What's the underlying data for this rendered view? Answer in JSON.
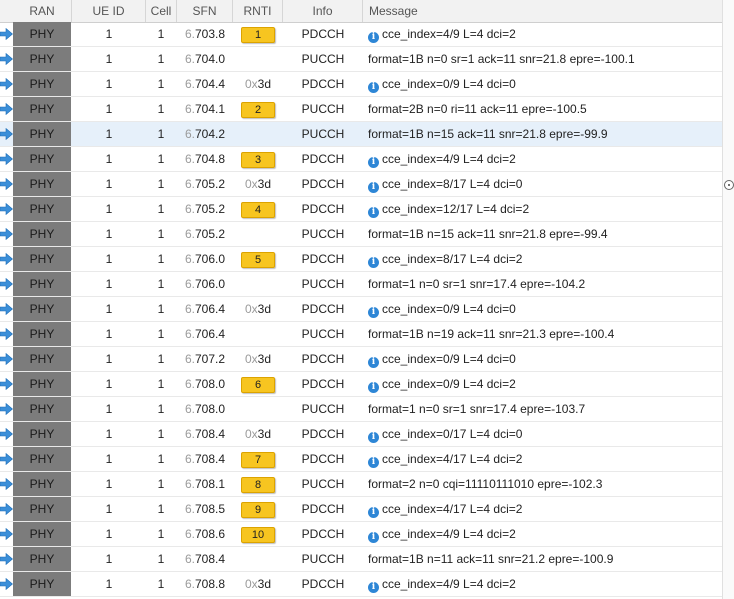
{
  "columns": {
    "ran": "RAN",
    "ue_id": "UE ID",
    "cell": "Cell",
    "sfn": "SFN",
    "rnti": "RNTI",
    "info": "Info",
    "message": "Message"
  },
  "colors": {
    "accent": "#2d86d6",
    "badge": "#f7c520",
    "ran_bg": "#7c7c7c",
    "selected_row": "#e6f0fa"
  },
  "rows": [
    {
      "ran": "PHY",
      "ue": "1",
      "cell": "1",
      "sfn_pre": "6.",
      "sfn": "703.8",
      "rnti_badge": "1",
      "rnti_pre": "",
      "rnti": "",
      "info": "PDCCH",
      "msg_icon": true,
      "msg": "cce_index=4/9 L=4 dci=2",
      "selected": false
    },
    {
      "ran": "PHY",
      "ue": "1",
      "cell": "1",
      "sfn_pre": "6.",
      "sfn": "704.0",
      "rnti_badge": "",
      "rnti_pre": "",
      "rnti": "",
      "info": "PUCCH",
      "msg_icon": false,
      "msg": "format=1B n=0 sr=1 ack=11 snr=21.8 epre=-100.1",
      "selected": false
    },
    {
      "ran": "PHY",
      "ue": "1",
      "cell": "1",
      "sfn_pre": "6.",
      "sfn": "704.4",
      "rnti_badge": "",
      "rnti_pre": "0x",
      "rnti": "3d",
      "info": "PDCCH",
      "msg_icon": true,
      "msg": "cce_index=0/9 L=4 dci=0",
      "selected": false
    },
    {
      "ran": "PHY",
      "ue": "1",
      "cell": "1",
      "sfn_pre": "6.",
      "sfn": "704.1",
      "rnti_badge": "2",
      "rnti_pre": "",
      "rnti": "",
      "info": "PUCCH",
      "msg_icon": false,
      "msg": "format=2B n=0 ri=11 ack=11 epre=-100.5",
      "selected": false
    },
    {
      "ran": "PHY",
      "ue": "1",
      "cell": "1",
      "sfn_pre": "6.",
      "sfn": "704.2",
      "rnti_badge": "",
      "rnti_pre": "",
      "rnti": "",
      "info": "PUCCH",
      "msg_icon": false,
      "msg": "format=1B n=15 ack=11 snr=21.8 epre=-99.9",
      "selected": true
    },
    {
      "ran": "PHY",
      "ue": "1",
      "cell": "1",
      "sfn_pre": "6.",
      "sfn": "704.8",
      "rnti_badge": "3",
      "rnti_pre": "",
      "rnti": "",
      "info": "PDCCH",
      "msg_icon": true,
      "msg": "cce_index=4/9 L=4 dci=2",
      "selected": false
    },
    {
      "ran": "PHY",
      "ue": "1",
      "cell": "1",
      "sfn_pre": "6.",
      "sfn": "705.2",
      "rnti_badge": "",
      "rnti_pre": "0x",
      "rnti": "3d",
      "info": "PDCCH",
      "msg_icon": true,
      "msg": "cce_index=8/17 L=4 dci=0",
      "selected": false
    },
    {
      "ran": "PHY",
      "ue": "1",
      "cell": "1",
      "sfn_pre": "6.",
      "sfn": "705.2",
      "rnti_badge": "4",
      "rnti_pre": "",
      "rnti": "",
      "info": "PDCCH",
      "msg_icon": true,
      "msg": "cce_index=12/17 L=4 dci=2",
      "selected": false
    },
    {
      "ran": "PHY",
      "ue": "1",
      "cell": "1",
      "sfn_pre": "6.",
      "sfn": "705.2",
      "rnti_badge": "",
      "rnti_pre": "",
      "rnti": "",
      "info": "PUCCH",
      "msg_icon": false,
      "msg": "format=1B n=15 ack=11 snr=21.8 epre=-99.4",
      "selected": false
    },
    {
      "ran": "PHY",
      "ue": "1",
      "cell": "1",
      "sfn_pre": "6.",
      "sfn": "706.0",
      "rnti_badge": "5",
      "rnti_pre": "",
      "rnti": "",
      "info": "PDCCH",
      "msg_icon": true,
      "msg": "cce_index=8/17 L=4 dci=2",
      "selected": false
    },
    {
      "ran": "PHY",
      "ue": "1",
      "cell": "1",
      "sfn_pre": "6.",
      "sfn": "706.0",
      "rnti_badge": "",
      "rnti_pre": "",
      "rnti": "",
      "info": "PUCCH",
      "msg_icon": false,
      "msg": "format=1 n=0 sr=1 snr=17.4 epre=-104.2",
      "selected": false
    },
    {
      "ran": "PHY",
      "ue": "1",
      "cell": "1",
      "sfn_pre": "6.",
      "sfn": "706.4",
      "rnti_badge": "",
      "rnti_pre": "0x",
      "rnti": "3d",
      "info": "PDCCH",
      "msg_icon": true,
      "msg": "cce_index=0/9 L=4 dci=0",
      "selected": false
    },
    {
      "ran": "PHY",
      "ue": "1",
      "cell": "1",
      "sfn_pre": "6.",
      "sfn": "706.4",
      "rnti_badge": "",
      "rnti_pre": "",
      "rnti": "",
      "info": "PUCCH",
      "msg_icon": false,
      "msg": "format=1B n=19 ack=11 snr=21.3 epre=-100.4",
      "selected": false
    },
    {
      "ran": "PHY",
      "ue": "1",
      "cell": "1",
      "sfn_pre": "6.",
      "sfn": "707.2",
      "rnti_badge": "",
      "rnti_pre": "0x",
      "rnti": "3d",
      "info": "PDCCH",
      "msg_icon": true,
      "msg": "cce_index=0/9 L=4 dci=0",
      "selected": false
    },
    {
      "ran": "PHY",
      "ue": "1",
      "cell": "1",
      "sfn_pre": "6.",
      "sfn": "708.0",
      "rnti_badge": "6",
      "rnti_pre": "",
      "rnti": "",
      "info": "PDCCH",
      "msg_icon": true,
      "msg": "cce_index=0/9 L=4 dci=2",
      "selected": false
    },
    {
      "ran": "PHY",
      "ue": "1",
      "cell": "1",
      "sfn_pre": "6.",
      "sfn": "708.0",
      "rnti_badge": "",
      "rnti_pre": "",
      "rnti": "",
      "info": "PUCCH",
      "msg_icon": false,
      "msg": "format=1 n=0 sr=1 snr=17.4 epre=-103.7",
      "selected": false
    },
    {
      "ran": "PHY",
      "ue": "1",
      "cell": "1",
      "sfn_pre": "6.",
      "sfn": "708.4",
      "rnti_badge": "",
      "rnti_pre": "0x",
      "rnti": "3d",
      "info": "PDCCH",
      "msg_icon": true,
      "msg": "cce_index=0/17 L=4 dci=0",
      "selected": false
    },
    {
      "ran": "PHY",
      "ue": "1",
      "cell": "1",
      "sfn_pre": "6.",
      "sfn": "708.4",
      "rnti_badge": "7",
      "rnti_pre": "",
      "rnti": "",
      "info": "PDCCH",
      "msg_icon": true,
      "msg": "cce_index=4/17 L=4 dci=2",
      "selected": false
    },
    {
      "ran": "PHY",
      "ue": "1",
      "cell": "1",
      "sfn_pre": "6.",
      "sfn": "708.1",
      "rnti_badge": "8",
      "rnti_pre": "",
      "rnti": "",
      "info": "PUCCH",
      "msg_icon": false,
      "msg": "format=2 n=0 cqi=11110111010 epre=-102.3",
      "selected": false
    },
    {
      "ran": "PHY",
      "ue": "1",
      "cell": "1",
      "sfn_pre": "6.",
      "sfn": "708.5",
      "rnti_badge": "9",
      "rnti_pre": "",
      "rnti": "",
      "info": "PDCCH",
      "msg_icon": true,
      "msg": "cce_index=4/17 L=4 dci=2",
      "selected": false
    },
    {
      "ran": "PHY",
      "ue": "1",
      "cell": "1",
      "sfn_pre": "6.",
      "sfn": "708.6",
      "rnti_badge": "10",
      "rnti_pre": "",
      "rnti": "",
      "info": "PDCCH",
      "msg_icon": true,
      "msg": "cce_index=4/9 L=4 dci=2",
      "selected": false
    },
    {
      "ran": "PHY",
      "ue": "1",
      "cell": "1",
      "sfn_pre": "6.",
      "sfn": "708.4",
      "rnti_badge": "",
      "rnti_pre": "",
      "rnti": "",
      "info": "PUCCH",
      "msg_icon": false,
      "msg": "format=1B n=11 ack=11 snr=21.2 epre=-100.9",
      "selected": false
    },
    {
      "ran": "PHY",
      "ue": "1",
      "cell": "1",
      "sfn_pre": "6.",
      "sfn": "708.8",
      "rnti_badge": "",
      "rnti_pre": "0x",
      "rnti": "3d",
      "info": "PDCCH",
      "msg_icon": true,
      "msg": "cce_index=4/9 L=4 dci=2",
      "selected": false
    }
  ],
  "icons": {
    "row_direction": "arrow-right-icon",
    "message_info": "info-icon",
    "scroll_handle": "scroll-handle-icon"
  },
  "info_glyph": "i"
}
